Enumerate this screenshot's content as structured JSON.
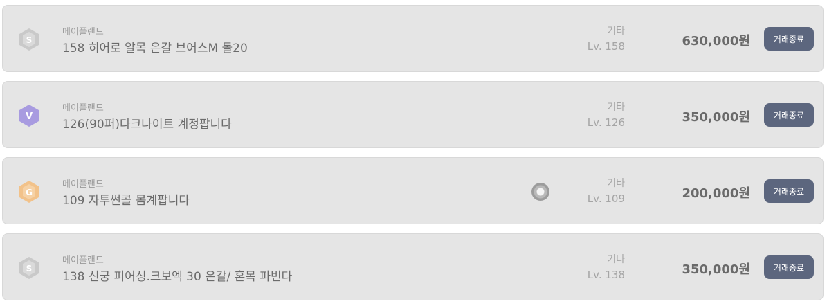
{
  "listings": [
    {
      "icon": "silver-grade-badge-icon",
      "icon_letter": "S",
      "icon_color": "#c9c9c9",
      "server": "메이플랜드",
      "title": "158 히어로 알목 은갈 브어스M 돌20",
      "category": "기타",
      "level": "Lv. 158",
      "price": "630,000원",
      "status_label": "거래종료"
    },
    {
      "icon": "violet-grade-badge-icon",
      "icon_letter": "V",
      "icon_color": "#a89be0",
      "server": "메이플랜드",
      "title": "126(90퍼)다크나이트 계정팝니다",
      "category": "기타",
      "level": "Lv. 126",
      "price": "350,000원",
      "status_label": "거래종료"
    },
    {
      "icon": "gold-grade-badge-icon",
      "icon_letter": "G",
      "icon_color": "#f2c28a",
      "server": "메이플랜드",
      "title": "109 자투썬콜 몸계팝니다",
      "category": "기타",
      "level": "Lv. 109",
      "price": "200,000원",
      "status_label": "거래종료",
      "has_avatar": true
    },
    {
      "icon": "silver-grade-badge-icon",
      "icon_letter": "S",
      "icon_color": "#c9c9c9",
      "server": "메이플랜드",
      "title": "138 신궁 피어싱.크보엑 30 은갈/ 혼목 파빈다",
      "category": "기타",
      "level": "Lv. 138",
      "price": "350,000원",
      "status_label": "거래종료"
    }
  ]
}
